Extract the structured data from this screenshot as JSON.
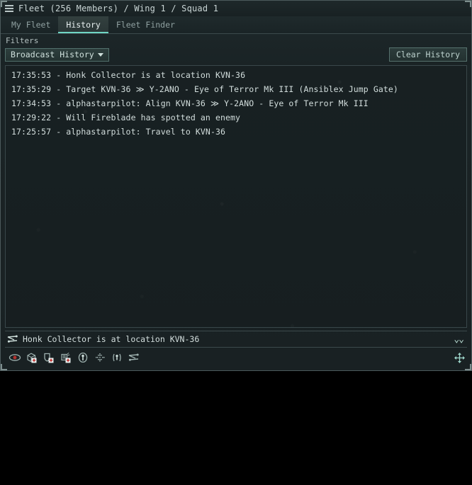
{
  "window": {
    "title": "Fleet (256 Members) / Wing 1 / Squad 1",
    "menu_icon": "hamburger-icon"
  },
  "tabs": [
    {
      "label": "My Fleet",
      "active": false
    },
    {
      "label": "History",
      "active": true
    },
    {
      "label": "Fleet Finder",
      "active": false
    }
  ],
  "filters": {
    "label": "Filters",
    "dropdown_value": "Broadcast History",
    "clear_button": "Clear History"
  },
  "history": [
    {
      "time": "17:35:53",
      "sep": "-",
      "text": "Honk Collector is at location KVN-36"
    },
    {
      "time": "17:35:29",
      "sep": "-",
      "text": "Target KVN-36 ≫ Y-2ANO - Eye of Terror Mk III (Ansiblex Jump Gate)"
    },
    {
      "time": "17:34:53",
      "sep": "-",
      "text": "alphastarpilot: Align KVN-36 ≫ Y-2ANO - Eye of Terror Mk III"
    },
    {
      "time": "17:29:22",
      "sep": "-",
      "text": "Will Fireblade has spotted an enemy"
    },
    {
      "time": "17:25:57",
      "sep": "-",
      "text": "alphastarpilot: Travel to KVN-36"
    }
  ],
  "broadcast_preview": {
    "icon": "align-location-icon",
    "text": "Honk Collector is at location KVN-36",
    "expand_icon": "double-chevron-down-icon"
  },
  "broadcast_buttons": [
    {
      "name": "watch-list-icon",
      "title": "Need Backup"
    },
    {
      "name": "armor-repair-icon",
      "title": "Armor"
    },
    {
      "name": "shield-repair-icon",
      "title": "Shield"
    },
    {
      "name": "capacitor-repair-icon",
      "title": "Capacitor"
    },
    {
      "name": "target-icon",
      "title": "Target"
    },
    {
      "name": "hold-position-icon",
      "title": "Hold Position"
    },
    {
      "name": "in-position-icon",
      "title": "In Position"
    },
    {
      "name": "align-to-icon",
      "title": "Align To"
    }
  ],
  "window_controls": {
    "resize_icon": "move-resize-icon"
  },
  "colors": {
    "accent": "#6fd6c4",
    "window_bg": "#1b2426",
    "text": "#d3dedd",
    "muted_text": "#8fa0a0",
    "border": "#3c4a4c"
  }
}
